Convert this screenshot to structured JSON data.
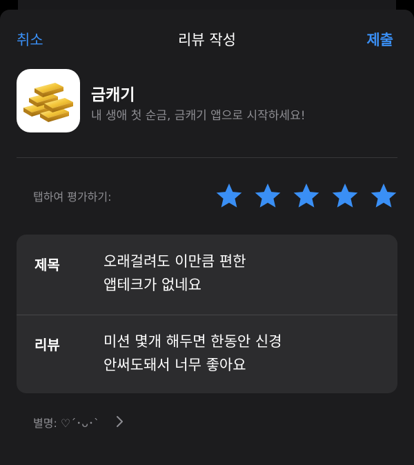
{
  "nav": {
    "cancel": "취소",
    "title": "리뷰 작성",
    "submit": "제출"
  },
  "app": {
    "name": "금캐기",
    "subtitle": "내 생애 첫 순금, 금캐기 앱으로 시작하세요!",
    "icon": "gold-bars-icon"
  },
  "rating": {
    "label": "탭하여 평가하기:",
    "stars": 5,
    "max": 5,
    "color": "#3a8ff5"
  },
  "review": {
    "title_label": "제목",
    "title_lines": [
      "오래걸려도 이만큼 편한",
      "앱테크가 없네요"
    ],
    "body_label": "리뷰",
    "body_lines": [
      "미션 몇개 해두면 한동안 신경",
      "안써도돼서 너무 좋아요"
    ]
  },
  "nickname": {
    "text": "별명: ♡´･ᴗ･`"
  },
  "colors": {
    "accent": "#3a8ff5",
    "sheet": "#1c1c1e",
    "card": "#2c2c2e"
  }
}
